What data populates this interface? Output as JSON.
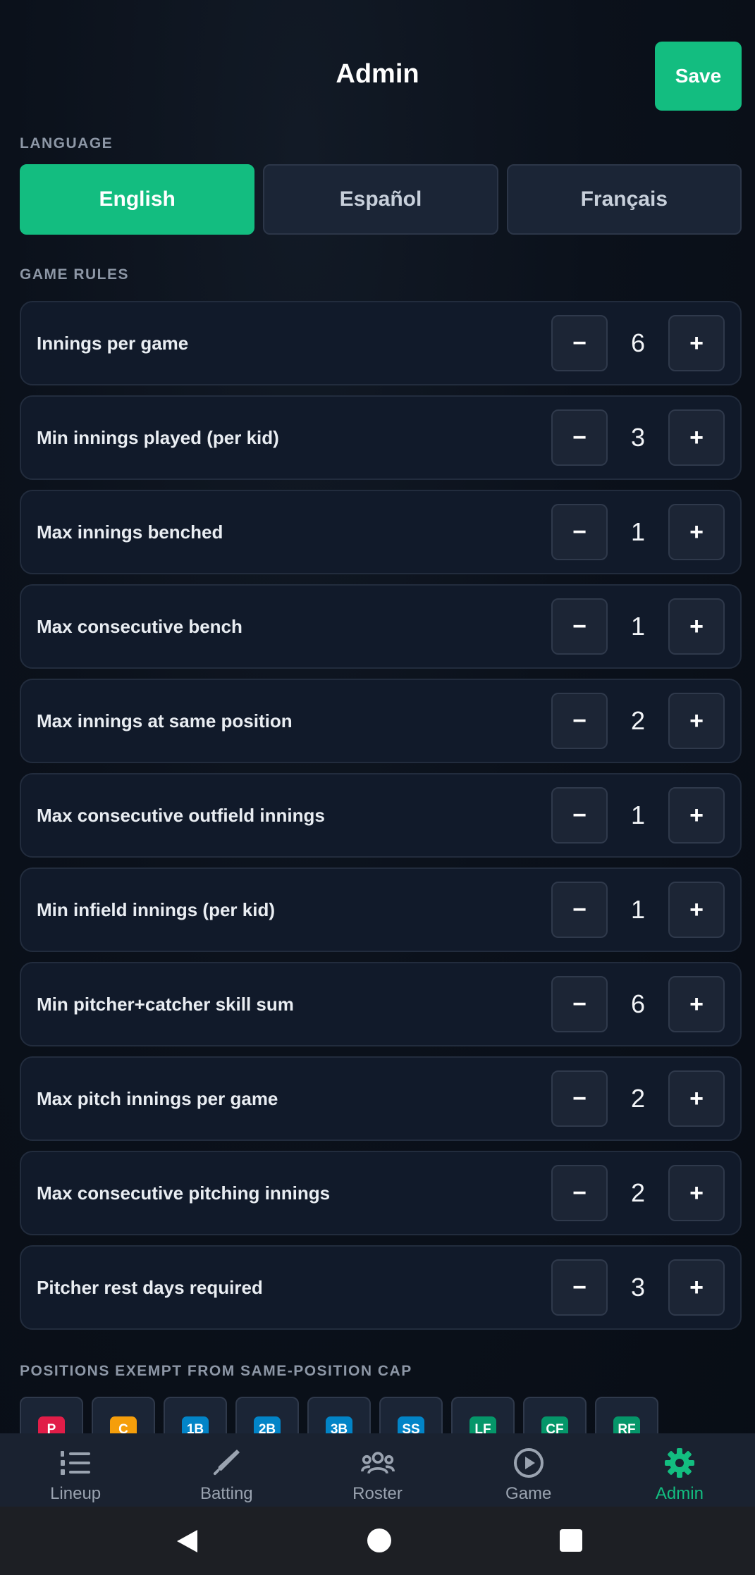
{
  "header": {
    "title": "Admin",
    "save_label": "Save"
  },
  "language": {
    "section_label": "LANGUAGE",
    "options": [
      {
        "label": "English",
        "selected": true
      },
      {
        "label": "Español",
        "selected": false
      },
      {
        "label": "Français",
        "selected": false
      }
    ]
  },
  "game_rules": {
    "section_label": "GAME RULES",
    "decrement_symbol": "−",
    "increment_symbol": "+",
    "rules": [
      {
        "label": "Innings per game",
        "value": "6"
      },
      {
        "label": "Min innings played (per kid)",
        "value": "3"
      },
      {
        "label": "Max innings benched",
        "value": "1"
      },
      {
        "label": "Max consecutive bench",
        "value": "1"
      },
      {
        "label": "Max innings at same position",
        "value": "2"
      },
      {
        "label": "Max consecutive outfield innings",
        "value": "1"
      },
      {
        "label": "Min infield innings (per kid)",
        "value": "1"
      },
      {
        "label": "Min pitcher+catcher skill sum",
        "value": "6"
      },
      {
        "label": "Max pitch innings per game",
        "value": "2"
      },
      {
        "label": "Max consecutive pitching innings",
        "value": "2"
      },
      {
        "label": "Pitcher rest days required",
        "value": "3"
      }
    ]
  },
  "exempt_positions": {
    "section_label": "POSITIONS EXEMPT FROM SAME-POSITION CAP",
    "positions": [
      {
        "label": "P",
        "color": "#e11d48"
      },
      {
        "label": "C",
        "color": "#f59e0b"
      },
      {
        "label": "1B",
        "color": "#0284c7"
      },
      {
        "label": "2B",
        "color": "#0284c7"
      },
      {
        "label": "3B",
        "color": "#0284c7"
      },
      {
        "label": "SS",
        "color": "#0284c7"
      },
      {
        "label": "LF",
        "color": "#059669"
      },
      {
        "label": "CF",
        "color": "#059669"
      },
      {
        "label": "RF",
        "color": "#059669"
      }
    ]
  },
  "tabs": [
    {
      "label": "Lineup",
      "icon": "list-ordered-icon",
      "active": false
    },
    {
      "label": "Batting",
      "icon": "bat-icon",
      "active": false
    },
    {
      "label": "Roster",
      "icon": "users-icon",
      "active": false
    },
    {
      "label": "Game",
      "icon": "play-circle-icon",
      "active": false
    },
    {
      "label": "Admin",
      "icon": "gear-icon",
      "active": true
    }
  ],
  "colors": {
    "accent": "#13bd80",
    "background": "#0b111b",
    "card": "#111a2a",
    "tab_inactive": "#9aa3b0"
  }
}
